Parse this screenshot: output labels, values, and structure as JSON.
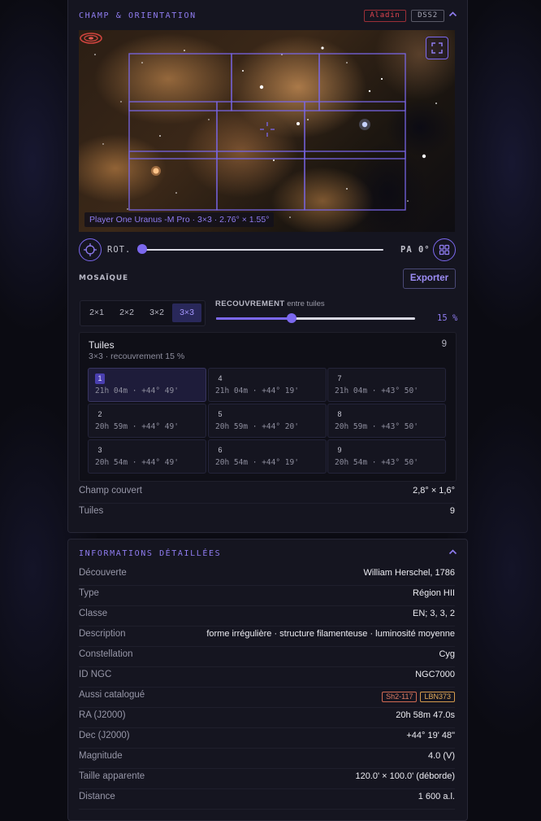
{
  "field_panel": {
    "title": "Champ & orientation",
    "badges": [
      "Aladin",
      "DSS2"
    ],
    "fov_label": "Player One Uranus -M Pro · 3×3 · 2.76° × 1.55°",
    "rotation_label": "ROT.",
    "rotation_value": 0,
    "pa_label": "PA 0°"
  },
  "mosaic": {
    "title": "MOSAÏQUE",
    "export_label": "Exporter",
    "grid_options": [
      "2×1",
      "2×2",
      "3×2",
      "3×3"
    ],
    "selected_grid": "3×3",
    "overlap_label_strong": "RECOUVREMENT",
    "overlap_label_rest": "entre tuiles",
    "overlap_percent": 15,
    "overlap_display": "15 %",
    "tiles_title": "Tuiles",
    "tiles_count": "9",
    "tiles_subtitle": "3×3 · recouvrement 15 %",
    "tiles": [
      {
        "num": "1",
        "coord": "21h 04m · +44° 49'",
        "active": true
      },
      {
        "num": "4",
        "coord": "21h 04m · +44° 19'"
      },
      {
        "num": "7",
        "coord": "21h 04m · +43° 50'"
      },
      {
        "num": "2",
        "coord": "20h 59m · +44° 49'"
      },
      {
        "num": "5",
        "coord": "20h 59m · +44° 20'"
      },
      {
        "num": "8",
        "coord": "20h 59m · +43° 50'"
      },
      {
        "num": "3",
        "coord": "20h 54m · +44° 49'"
      },
      {
        "num": "6",
        "coord": "20h 54m · +44° 19'"
      },
      {
        "num": "9",
        "coord": "20h 54m · +43° 50'"
      }
    ],
    "summary": [
      {
        "label": "Champ couvert",
        "value": "2,8° × 1,6°"
      },
      {
        "label": "Tuiles",
        "value": "9"
      }
    ]
  },
  "details": {
    "title": "Informations détaillées",
    "rows": [
      {
        "label": "Découverte",
        "value": "William Herschel, 1786"
      },
      {
        "label": "Type",
        "value": "Région HII"
      },
      {
        "label": "Classe",
        "value": "EN; 3, 3, 2"
      },
      {
        "label": "Description",
        "value": "forme irrégulière · structure filamenteuse · luminosité moyenne"
      },
      {
        "label": "Constellation",
        "value": "Cyg"
      },
      {
        "label": "ID NGC",
        "value": "NGC7000"
      },
      {
        "label": "Aussi catalogué",
        "pills": [
          "Sh2-117",
          "LBN373"
        ]
      },
      {
        "label": "RA (J2000)",
        "value": "20h 58m 47.0s"
      },
      {
        "label": "Dec (J2000)",
        "value": "+44° 19' 48\""
      },
      {
        "label": "Magnitude",
        "value": "4.0 (V)"
      },
      {
        "label": "Taille apparente",
        "value": "120.0' × 100.0' (déborde)"
      },
      {
        "label": "Distance",
        "value": "1 600 a.l."
      }
    ]
  },
  "colors": {
    "accent": "#7b68ee",
    "alert": "#e0454f"
  }
}
